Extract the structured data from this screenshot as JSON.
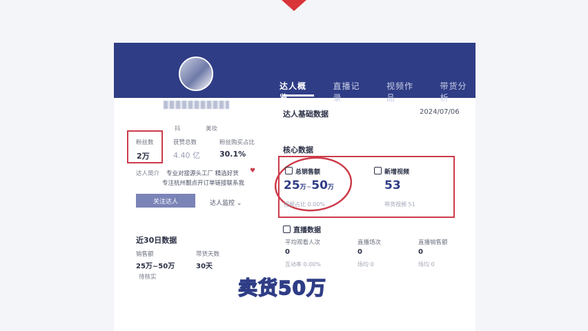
{
  "header": {
    "tabs": [
      {
        "label": "达人概览"
      },
      {
        "label": "直播记录"
      },
      {
        "label": "视频作品"
      },
      {
        "label": "带货分析"
      }
    ]
  },
  "profile": {
    "meta_a": "抖",
    "meta_b": "美妆",
    "stats": [
      {
        "label": "粉丝数",
        "value": "2万"
      },
      {
        "label": "获赞总数",
        "value": "4.40 亿"
      },
      {
        "label": "粉丝购买占比",
        "value": "30.1%"
      }
    ],
    "intro_prefix": "达人简介",
    "intro_line1": "专业对接源头工厂 精选好货",
    "intro_line2": "专注杭州靓点开订单链接联系我",
    "follow_label": "关注达人",
    "monitor_label": "达人监控",
    "monitor_chevron": "⌄"
  },
  "recent30": {
    "title": "近30日数据",
    "sales_label": "销售额",
    "sales_value": "25万~50万",
    "days_label": "带货天数",
    "days_value": "30天",
    "note": "待核实"
  },
  "basic": {
    "title": "达人基础数据",
    "date": "2024/07/06"
  },
  "core": {
    "title": "核心数据",
    "total_sales_label": "总销售额",
    "total_sales_value_a": "25",
    "total_sales_unit_a": "万",
    "total_sales_sep": "~",
    "total_sales_value_b": "50",
    "total_sales_unit_b": "万",
    "total_sales_sub": "视频占比 0.00%",
    "new_videos_label": "新增视频",
    "new_videos_value": "53",
    "new_videos_sub": "带货视频 51"
  },
  "live": {
    "title": "直播数据",
    "cols": [
      {
        "label": "平均观看人次",
        "value": "0",
        "sub": "互动率 0.00%"
      },
      {
        "label": "直播场次",
        "value": "0",
        "sub": "场均 0"
      },
      {
        "label": "直播销售额",
        "value": "0",
        "sub": "场均 0"
      }
    ]
  },
  "caption": "卖货50万",
  "colors": {
    "brand": "#2f3d86",
    "highlight": "#cc3b4a",
    "arrow": "#d9343a"
  }
}
